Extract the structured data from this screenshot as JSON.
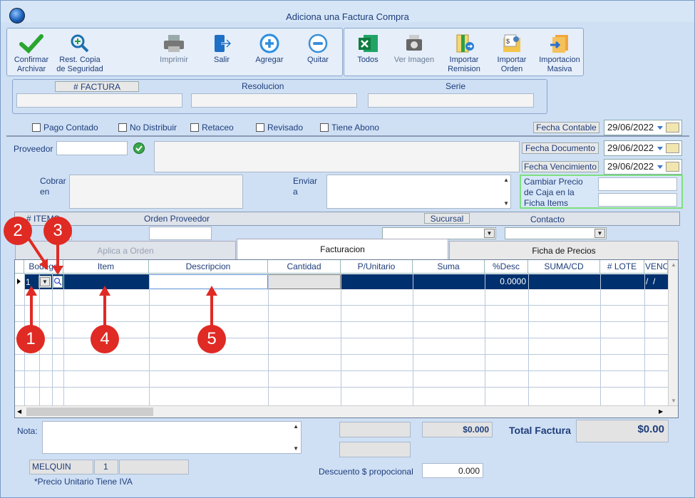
{
  "window": {
    "title": "Adiciona una Factura Compra"
  },
  "toolbar": [
    {
      "icon": "check-icon",
      "label1": "Confirmar",
      "label2": "Archivar",
      "disabled": false
    },
    {
      "icon": "restore-search-icon",
      "label1": "Rest. Copia",
      "label2": "de Seguridad",
      "disabled": false
    },
    {
      "icon": "printer-icon",
      "label1": "Imprimir",
      "label2": "",
      "disabled": true
    },
    {
      "icon": "exit-door-icon",
      "label1": "Salir",
      "label2": "",
      "disabled": false
    },
    {
      "icon": "plus-circle-icon",
      "label1": "Agregar",
      "label2": "",
      "disabled": false
    },
    {
      "icon": "minus-circle-icon",
      "label1": "Quitar",
      "label2": "",
      "disabled": false
    },
    {
      "icon": "excel-icon",
      "label1": "Todos",
      "label2": "",
      "disabled": false
    },
    {
      "icon": "camera-icon",
      "label1": "Ver Imagen",
      "label2": "",
      "disabled": true
    },
    {
      "icon": "import-remision-icon",
      "label1": "Importar",
      "label2": "Remision",
      "disabled": false
    },
    {
      "icon": "import-order-icon",
      "label1": "Importar",
      "label2": "Orden",
      "disabled": false
    },
    {
      "icon": "mass-import-icon",
      "label1": "Importacion",
      "label2": "Masiva",
      "disabled": false
    }
  ],
  "header_fields": {
    "factura": "# FACTURA",
    "resolucion": "Resolucion",
    "serie": "Serie"
  },
  "checkboxes": {
    "pago_contado": "Pago Contado",
    "no_distribuir": "No Distribuir",
    "retaceo": "Retaceo",
    "revisado": "Revisado",
    "tiene_abono": "Tiene Abono"
  },
  "dates": {
    "contable": {
      "label": "Fecha Contable",
      "value": "29/06/2022"
    },
    "documento": {
      "label": "Fecha Documento",
      "value": "29/06/2022"
    },
    "vencimiento": {
      "label": "Fecha Vencimiento",
      "value": "29/06/2022"
    }
  },
  "labels": {
    "proveedor": "Proveedor",
    "cobrar": "Cobrar",
    "cobrar2": "en",
    "enviar": "Enviar",
    "enviar2": "a",
    "cambiar1": "Cambiar Precio",
    "cambiar2": "de Caja en la",
    "cambiar3": "Ficha Items",
    "items": "# ITEMS",
    "orden_proveedor": "Orden Proveedor",
    "sucursal": "Sucursal",
    "contacto": "Contacto"
  },
  "tabs": {
    "aplica": "Aplica a Orden",
    "facturacion": "Facturacion",
    "ficha": "Ficha de Precios"
  },
  "grid": {
    "columns": [
      "Bodega",
      "Item",
      "Descripcion",
      "Cantidad",
      "P/Unitario",
      "Suma",
      "%Desc",
      "SUMA/CD",
      "# LOTE",
      "VENC"
    ],
    "row1": {
      "bodega": "1",
      "desc_pct": "0.0000",
      "venc": "/  /"
    }
  },
  "markers": [
    "1",
    "2",
    "3",
    "4",
    "5"
  ],
  "footer": {
    "nota": "Nota:",
    "subtotal": "$0.000",
    "total_label": "Total Factura",
    "total_value": "$0.00",
    "user": "MELQUIN",
    "user_num": "1",
    "descuento_label": "Descuento $ propocional",
    "descuento_value": "0.000",
    "note": "*Precio Unitario Tiene IVA"
  }
}
